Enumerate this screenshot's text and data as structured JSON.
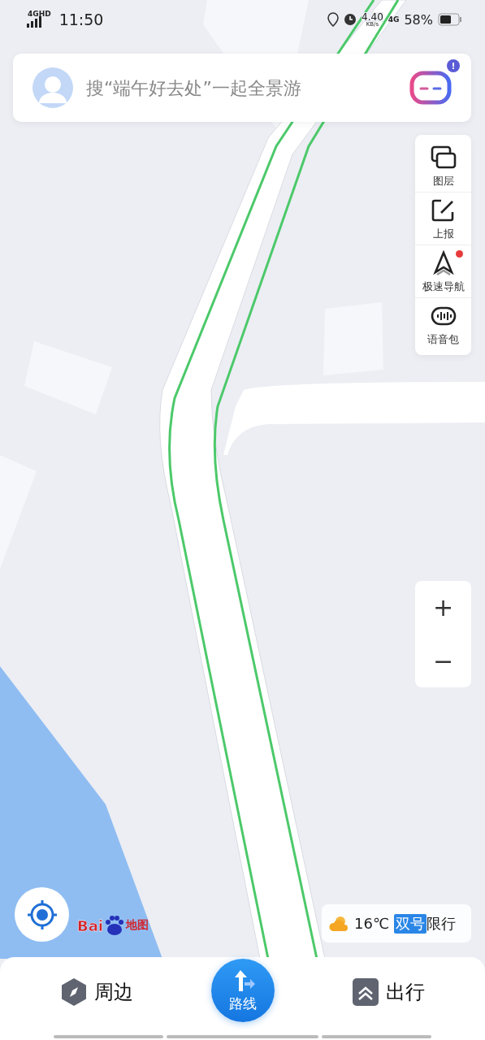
{
  "status_bar": {
    "network": "4G",
    "network_badge": "HD",
    "time": "11:50",
    "speed": "4.40",
    "speed_unit": "KB/s",
    "data_network": "4G",
    "battery": "58%"
  },
  "search": {
    "placeholder": "搜“端午好去处”一起全景游",
    "assistant_alert": "!"
  },
  "side_tools": [
    {
      "label": "图层",
      "dot": false
    },
    {
      "label": "上报",
      "dot": false
    },
    {
      "label": "极速导航",
      "dot": true
    },
    {
      "label": "语音包",
      "dot": false
    }
  ],
  "zoom": {
    "in": "+",
    "out": "−"
  },
  "logo": {
    "left": "Bai",
    "right": "地图"
  },
  "weather": {
    "temperature": "16℃",
    "plate_tag": "双号",
    "restriction": "限行"
  },
  "bottom_nav": [
    {
      "label": "周边",
      "kind": "side"
    },
    {
      "label": "路线",
      "kind": "primary"
    },
    {
      "label": "出行",
      "kind": "side"
    }
  ]
}
